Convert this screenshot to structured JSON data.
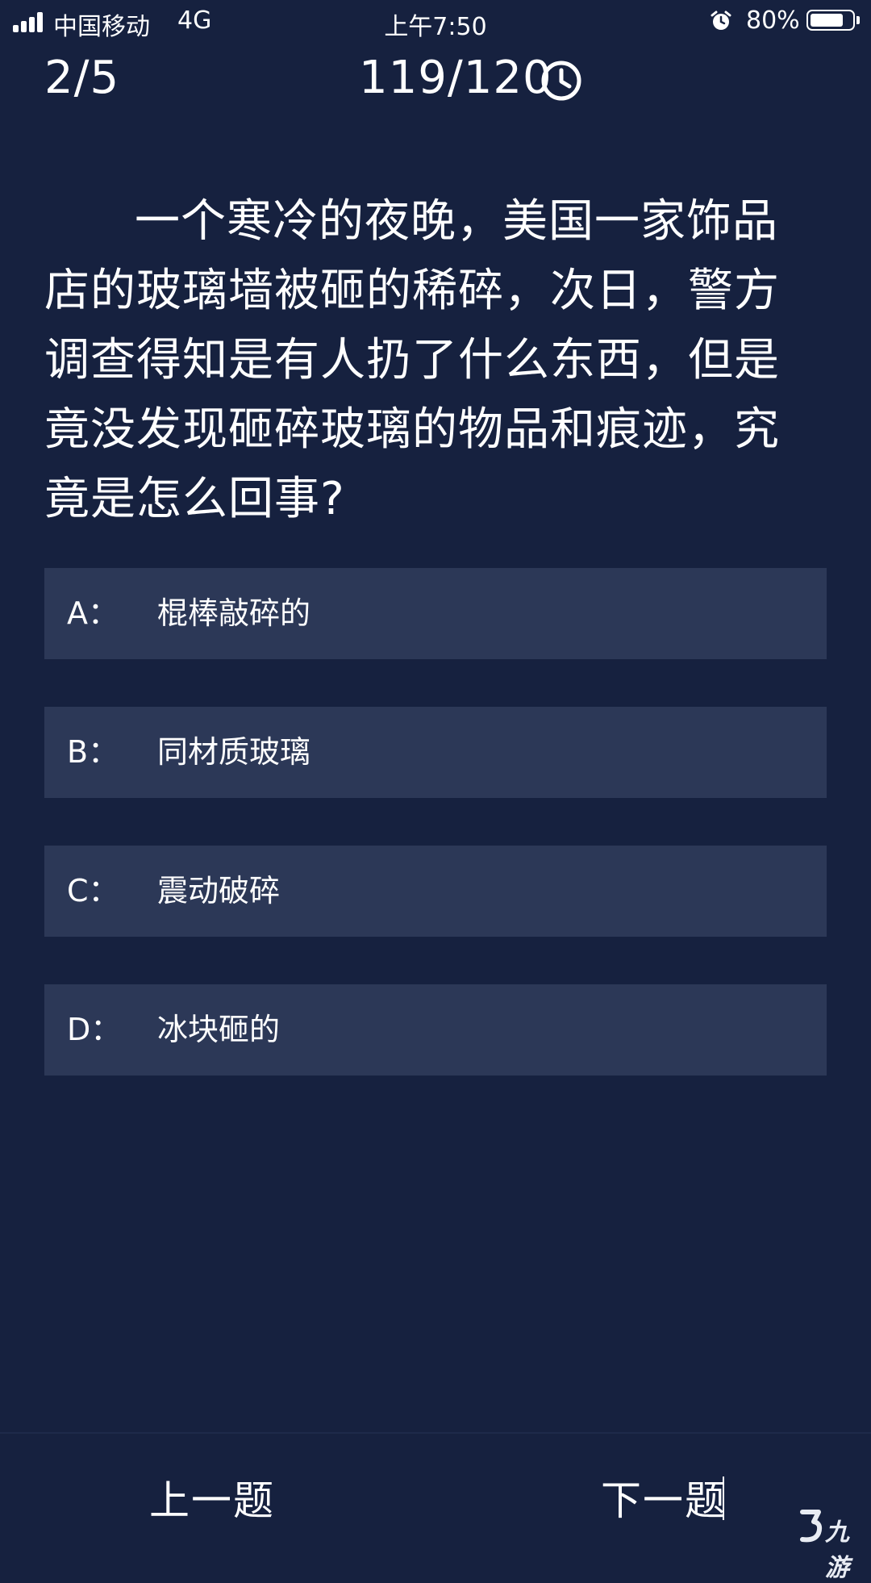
{
  "status_bar": {
    "carrier": "中国移动",
    "network": "4G",
    "time": "上午7:50",
    "battery_percent": "80%",
    "battery_level": 0.8,
    "icons": [
      "signal-icon",
      "alarm-icon",
      "battery-icon"
    ]
  },
  "header": {
    "progress": "2/5",
    "timer": "119/120",
    "timer_icon": "clock-icon"
  },
  "question": {
    "text": "一个寒冷的夜晚，美国一家饰品店的玻璃墙被砸的稀碎，次日，警方调查得知是有人扔了什么东西，但是竟没发现砸碎玻璃的物品和痕迹，究竟是怎么回事?"
  },
  "options": [
    {
      "letter": "A：",
      "text": "棍棒敲碎的"
    },
    {
      "letter": "B：",
      "text": "同材质玻璃"
    },
    {
      "letter": "C：",
      "text": "震动破碎"
    },
    {
      "letter": "D：",
      "text": "冰块砸的"
    }
  ],
  "nav": {
    "prev_label": "上一题",
    "next_label": "下一题"
  },
  "watermark": {
    "text": "九游"
  },
  "colors": {
    "background": "#16213f",
    "option_background": "#2c3857",
    "text": "#ffffff"
  }
}
